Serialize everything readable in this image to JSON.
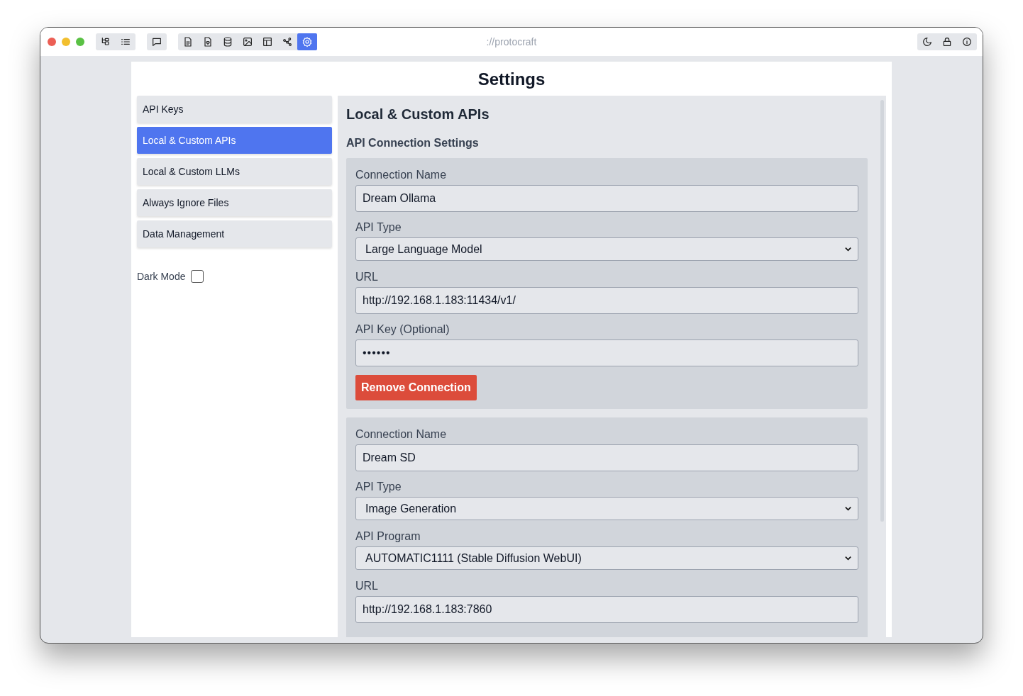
{
  "toolbar": {
    "groups": [
      {
        "items": [
          {
            "selected": false
          },
          {
            "selected": false
          }
        ]
      },
      {
        "items": [
          {
            "selected": false
          }
        ]
      },
      {
        "items": [
          {
            "selected": false
          },
          {
            "selected": false
          },
          {
            "selected": false
          },
          {
            "selected": false
          },
          {
            "selected": false
          },
          {
            "selected": false
          },
          {
            "selected": true
          }
        ]
      }
    ],
    "address": "://protocraft",
    "right_items": [
      {
        "selected": false
      },
      {
        "selected": false
      },
      {
        "selected": false
      }
    ]
  },
  "settings": {
    "title": "Settings",
    "sidebar": {
      "items": [
        {
          "label": "API Keys",
          "selected": false
        },
        {
          "label": "Local & Custom APIs",
          "selected": true
        },
        {
          "label": "Local & Custom LLMs",
          "selected": false
        },
        {
          "label": "Always Ignore Files",
          "selected": false
        },
        {
          "label": "Data Management",
          "selected": false
        }
      ],
      "dark_mode": {
        "label": "Dark Mode",
        "checked": false
      }
    },
    "main": {
      "heading": "Local & Custom APIs",
      "subheading": "API Connection Settings",
      "connections": [
        {
          "fields": [
            {
              "kind": "text",
              "label": "Connection Name",
              "value": "Dream Ollama"
            },
            {
              "kind": "select",
              "label": "API Type",
              "value": "Large Language Model"
            },
            {
              "kind": "text",
              "label": "URL",
              "value": "http://192.168.1.183:11434/v1/"
            },
            {
              "kind": "password",
              "label": "API Key (Optional)",
              "value": "••••••"
            }
          ],
          "button": "Remove Connection"
        },
        {
          "fields": [
            {
              "kind": "text",
              "label": "Connection Name",
              "value": "Dream SD"
            },
            {
              "kind": "select",
              "label": "API Type",
              "value": "Image Generation"
            },
            {
              "kind": "select",
              "label": "API Program",
              "value": "AUTOMATIC1111 (Stable Diffusion WebUI)"
            },
            {
              "kind": "text",
              "label": "URL",
              "value": "http://192.168.1.183:7860"
            }
          ]
        }
      ]
    }
  }
}
